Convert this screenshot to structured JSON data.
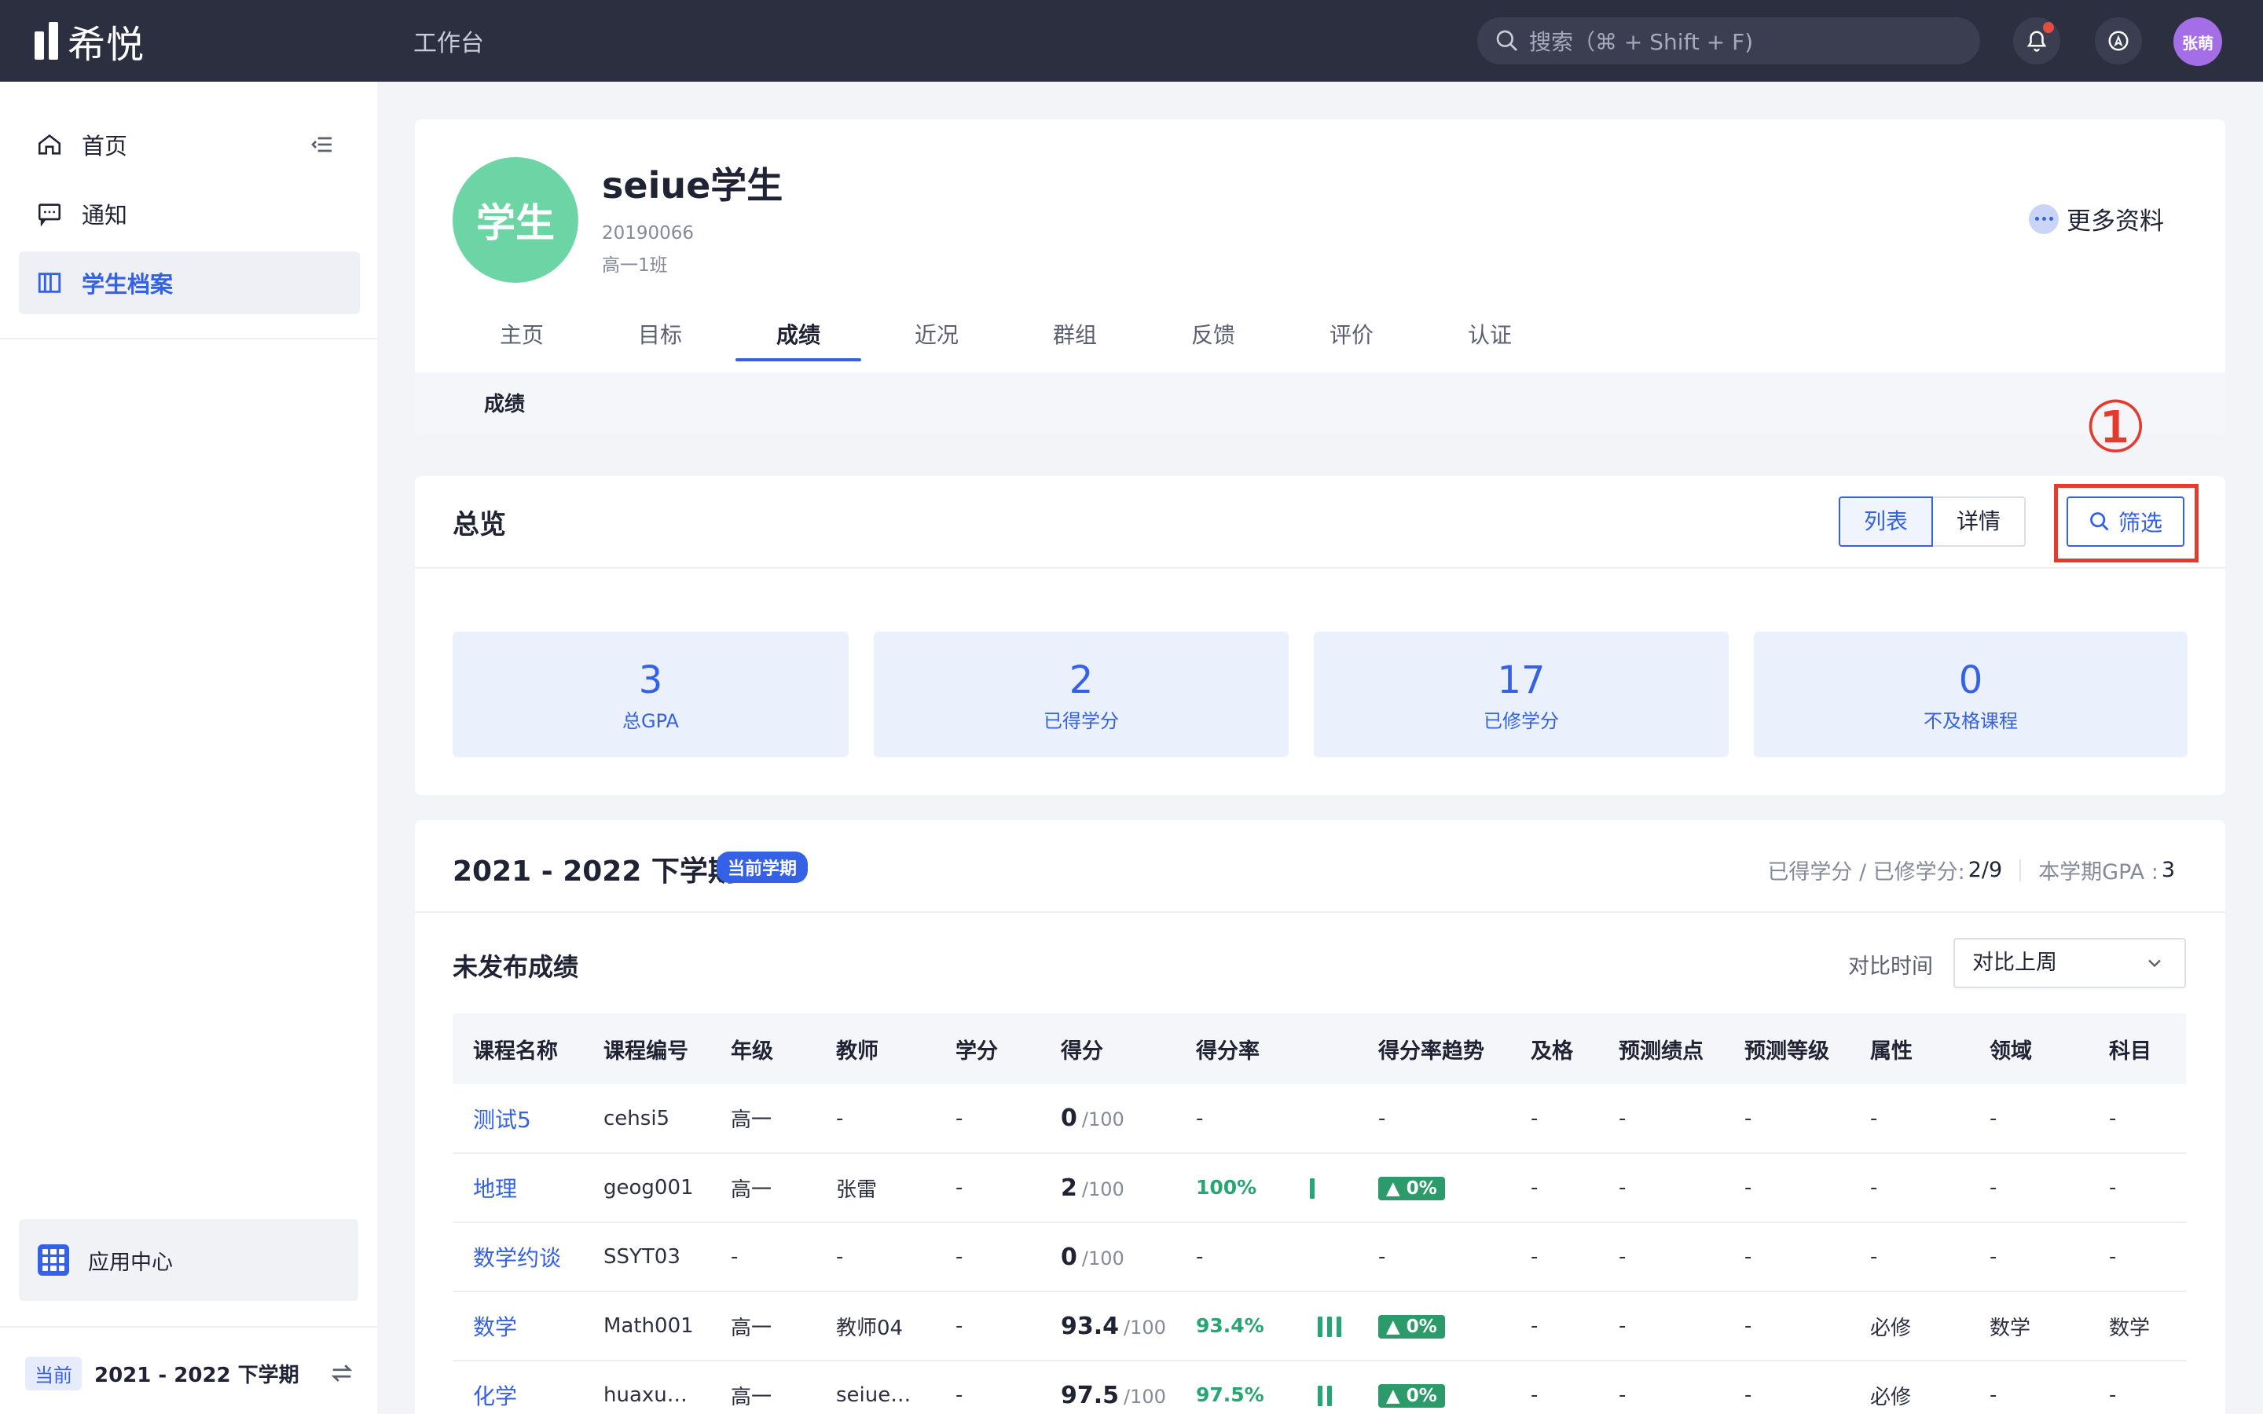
{
  "topbar": {
    "logo_text": "希悦",
    "workbench": "工作台",
    "search_placeholder": "搜索（⌘ + Shift + F)",
    "user_initials": "张萌"
  },
  "sidebar": {
    "items": [
      {
        "label": "首页",
        "icon": "home-icon"
      },
      {
        "label": "通知",
        "icon": "message-icon"
      },
      {
        "label": "学生档案",
        "icon": "archive-icon"
      }
    ],
    "app_center": "应用中心",
    "term_tag": "当前",
    "term_value": "2021 - 2022 下学期"
  },
  "profile": {
    "avatar_text": "学生",
    "name": "seiue学生",
    "student_id": "20190066",
    "class_name": "高一1班",
    "more_info": "更多资料",
    "tabs": [
      "主页",
      "目标",
      "成绩",
      "近况",
      "群组",
      "反馈",
      "评价",
      "认证"
    ],
    "active_tab": "成绩",
    "subtab": "成绩"
  },
  "overview": {
    "title": "总览",
    "view_list": "列表",
    "view_detail": "详情",
    "filter": "筛选",
    "annotation": "①",
    "stats": [
      {
        "value": "3",
        "label": "总GPA"
      },
      {
        "value": "2",
        "label": "已得学分"
      },
      {
        "value": "17",
        "label": "已修学分"
      },
      {
        "value": "0",
        "label": "不及格课程"
      }
    ]
  },
  "semester": {
    "title": "2021 - 2022 下学期",
    "badge": "当前学期",
    "credits_label": "已得学分 / 已修学分:",
    "credits_value": "2/9",
    "gpa_label": "本学期GPA :",
    "gpa_value": "3",
    "section_title": "未发布成绩",
    "compare_label": "对比时间",
    "compare_value": "对比上周",
    "columns": [
      "课程名称",
      "课程编号",
      "年级",
      "教师",
      "学分",
      "得分",
      "得分率",
      "得分率趋势",
      "及格",
      "预测绩点",
      "预测等级",
      "属性",
      "领域",
      "科目"
    ],
    "rows": [
      {
        "course": "测试5",
        "code": "cehsi5",
        "grade": "高一",
        "teacher": "-",
        "credit": "-",
        "score": "0",
        "score_max": "/100",
        "rate": "-",
        "rate_bars": 0,
        "trend": "-",
        "pass": "-",
        "pred_gpa": "-",
        "pred_level": "-",
        "attr": "-",
        "domain": "-",
        "subject": "-"
      },
      {
        "course": "地理",
        "code": "geog001",
        "grade": "高一",
        "teacher": "张雷",
        "credit": "-",
        "score": "2",
        "score_max": "/100",
        "rate": "100%",
        "rate_bars": 1,
        "trend": "▲ 0%",
        "pass": "-",
        "pred_gpa": "-",
        "pred_level": "-",
        "attr": "-",
        "domain": "-",
        "subject": "-"
      },
      {
        "course": "数学约谈",
        "code": "SSYT03",
        "grade": "-",
        "teacher": "-",
        "credit": "-",
        "score": "0",
        "score_max": "/100",
        "rate": "-",
        "rate_bars": 0,
        "trend": "-",
        "pass": "-",
        "pred_gpa": "-",
        "pred_level": "-",
        "attr": "-",
        "domain": "-",
        "subject": "-"
      },
      {
        "course": "数学",
        "code": "Math001",
        "grade": "高一",
        "teacher": "教师04",
        "credit": "-",
        "score": "93.4",
        "score_max": "/100",
        "rate": "93.4%",
        "rate_bars": 3,
        "trend": "▲ 0%",
        "pass": "-",
        "pred_gpa": "-",
        "pred_level": "-",
        "attr": "必修",
        "domain": "数学",
        "subject": "数学"
      },
      {
        "course": "化学",
        "code": "huaxu…",
        "grade": "高一",
        "teacher": "seiue…",
        "credit": "-",
        "score": "97.5",
        "score_max": "/100",
        "rate": "97.5%",
        "rate_bars": 2,
        "trend": "▲ 0%",
        "pass": "-",
        "pred_gpa": "-",
        "pred_level": "-",
        "attr": "必修",
        "domain": "-",
        "subject": "-"
      }
    ]
  }
}
